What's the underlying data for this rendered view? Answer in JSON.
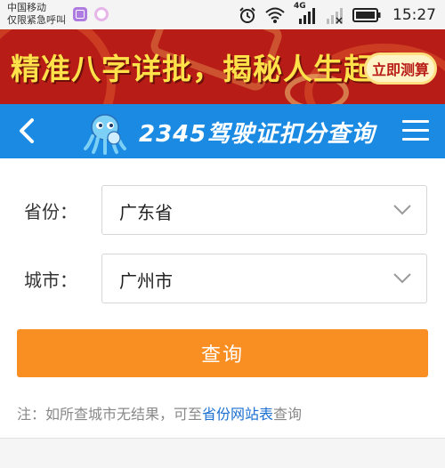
{
  "status_bar": {
    "carrier": "中国移动",
    "emergency": "仅限紧急呼叫",
    "network": "4G",
    "time": "15:27"
  },
  "banner": {
    "slogan": "精准八字详批，揭秘人生起伏",
    "button": "立即测算",
    "colors": {
      "background": "#b81c16",
      "text": "#ffe14a"
    }
  },
  "header": {
    "title": "2345驾驶证扣分查询",
    "back_icon": "chevron-left-icon",
    "menu_icon": "hamburger-menu-icon",
    "color": "#1a8ae3"
  },
  "form": {
    "province": {
      "label": "省份：",
      "value": "广东省"
    },
    "city": {
      "label": "城市：",
      "value": "广州市"
    }
  },
  "query_button": {
    "label": "查询",
    "color": "#f98e22"
  },
  "note": {
    "prefix": "注：如所查城市无结果，可至",
    "link": "省份网站表",
    "suffix": "查询"
  }
}
